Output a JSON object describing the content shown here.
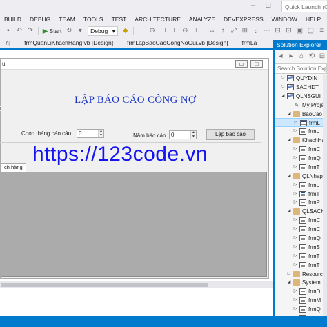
{
  "window": {
    "quick_launch_placeholder": "Quick Launch (Ct",
    "minimize_glyph": "–",
    "restore_glyph": "□"
  },
  "menu": [
    "BUILD",
    "DEBUG",
    "TEAM",
    "TOOLS",
    "TEST",
    "ARCHITECTURE",
    "ANALYZE",
    "DEVEXPRESS",
    "WINDOW",
    "HELP"
  ],
  "toolbar": {
    "start_label": "Start",
    "config_value": "Debug"
  },
  "doc_tabs": [
    {
      "label": "n]",
      "active": false
    },
    {
      "label": "frmQuanLiKhachHang.vb [Design]",
      "active": false
    },
    {
      "label": "frmLapBaoCaoCongNoGui.vb [Design]",
      "active": false
    },
    {
      "label": "frmLa",
      "active": false
    }
  ],
  "form": {
    "caption": "ui",
    "title": "LẬP BÁO CÁO CÔNG NỢ",
    "group_label": "i",
    "month_label": "Chọn tháng báo cáo",
    "month_value": "0",
    "year_label": "Năm báo cáo",
    "year_value": "0",
    "report_button": "Lập báo cáo",
    "tab_label": "ch hàng",
    "watermark": "https://123code.vn"
  },
  "solution_explorer": {
    "title": "Solution Explorer",
    "search_placeholder": "Search Solution Explo",
    "items": [
      {
        "label": "QUYDIN",
        "icon": "project",
        "indent": 2,
        "twisty": "closed"
      },
      {
        "label": "SACHDT",
        "icon": "project",
        "indent": 2,
        "twisty": "closed"
      },
      {
        "label": "QLNSGUI",
        "icon": "project",
        "indent": 2,
        "twisty": "open"
      },
      {
        "label": "My Proje",
        "icon": "wrench",
        "indent": 3,
        "twisty": "none"
      },
      {
        "label": "BaoCao",
        "icon": "folder",
        "indent": 3,
        "twisty": "open"
      },
      {
        "label": "frmL",
        "icon": "form",
        "indent": 4,
        "twisty": "closed",
        "selected": true
      },
      {
        "label": "frmL",
        "icon": "form",
        "indent": 4,
        "twisty": "closed"
      },
      {
        "label": "KhachHa",
        "icon": "folder",
        "indent": 3,
        "twisty": "open"
      },
      {
        "label": "frmC",
        "icon": "form",
        "indent": 4,
        "twisty": "closed"
      },
      {
        "label": "frmQ",
        "icon": "form",
        "indent": 4,
        "twisty": "closed"
      },
      {
        "label": "frmT",
        "icon": "form",
        "indent": 4,
        "twisty": "closed"
      },
      {
        "label": "QLNhap",
        "icon": "folder",
        "indent": 3,
        "twisty": "open"
      },
      {
        "label": "frmL",
        "icon": "form",
        "indent": 4,
        "twisty": "closed"
      },
      {
        "label": "frmT",
        "icon": "form",
        "indent": 4,
        "twisty": "closed"
      },
      {
        "label": "frmP",
        "icon": "form",
        "indent": 4,
        "twisty": "closed"
      },
      {
        "label": "QLSACH",
        "icon": "folder",
        "indent": 3,
        "twisty": "open"
      },
      {
        "label": "frmC",
        "icon": "form",
        "indent": 4,
        "twisty": "closed"
      },
      {
        "label": "frmC",
        "icon": "form",
        "indent": 4,
        "twisty": "closed"
      },
      {
        "label": "frmQ",
        "icon": "form",
        "indent": 4,
        "twisty": "closed"
      },
      {
        "label": "frmS",
        "icon": "form",
        "indent": 4,
        "twisty": "closed"
      },
      {
        "label": "frmT",
        "icon": "form",
        "indent": 4,
        "twisty": "closed"
      },
      {
        "label": "frmT",
        "icon": "form",
        "indent": 4,
        "twisty": "closed"
      },
      {
        "label": "Resource",
        "icon": "folder",
        "indent": 3,
        "twisty": "closed"
      },
      {
        "label": "System",
        "icon": "folder",
        "indent": 3,
        "twisty": "open"
      },
      {
        "label": "frmD",
        "icon": "form",
        "indent": 4,
        "twisty": "closed"
      },
      {
        "label": "frmM",
        "icon": "form",
        "indent": 4,
        "twisty": "closed"
      },
      {
        "label": "frmQ",
        "icon": "form",
        "indent": 4,
        "twisty": "closed"
      },
      {
        "label": "frmS",
        "icon": "form",
        "indent": 4,
        "twisty": "closed"
      }
    ]
  },
  "colors": {
    "accent": "#007acc",
    "title_text": "#1a34c8",
    "watermark": "#1414f0",
    "grid": "#ababab"
  }
}
